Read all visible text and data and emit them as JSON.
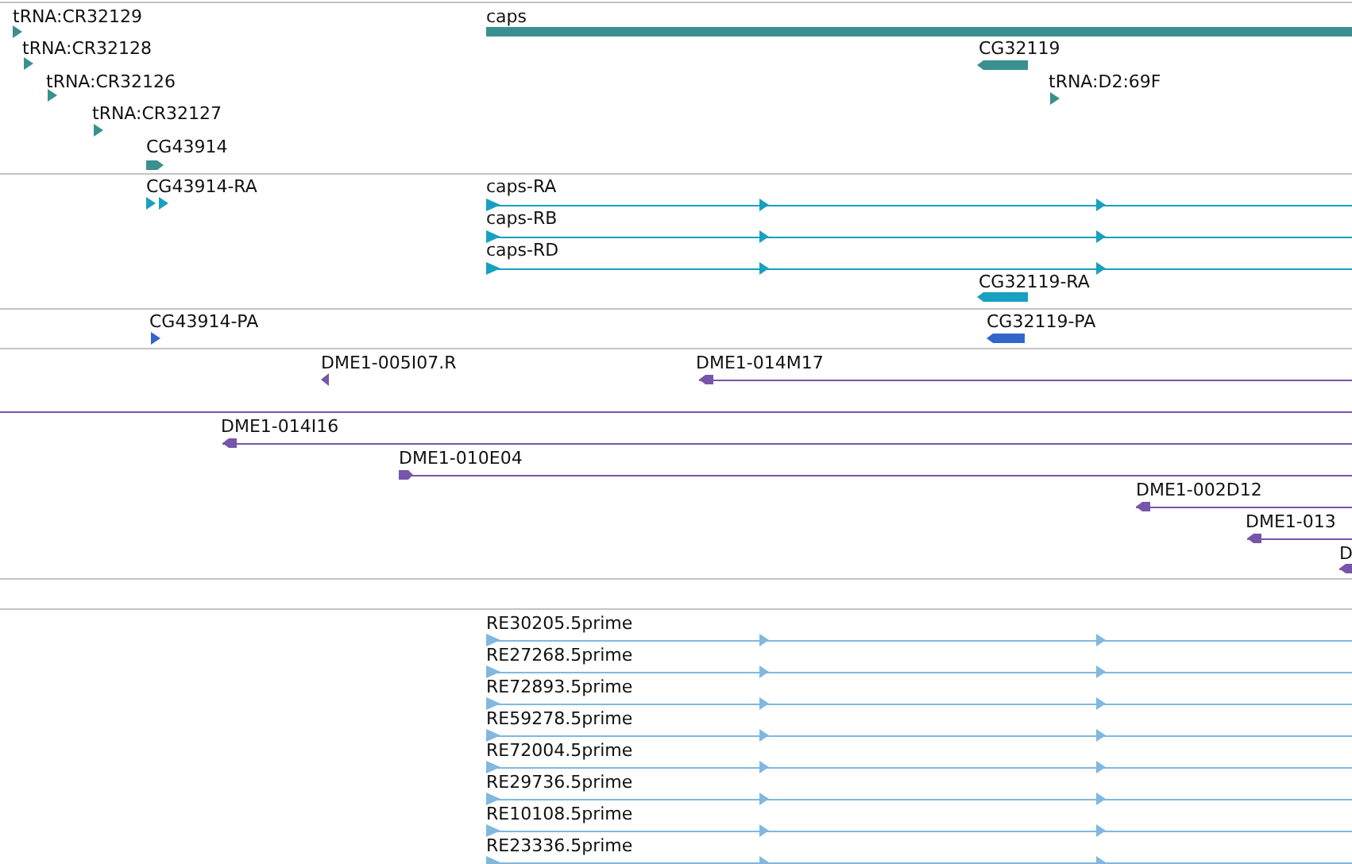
{
  "tracks": [
    {
      "color": "#3a9090",
      "features": [
        {
          "kind": "marker",
          "label": "tRNA:CR32129",
          "reverse": false
        },
        {
          "kind": "bar",
          "label": "caps"
        },
        {
          "kind": "marker",
          "label": "tRNA:CR32128",
          "reverse": false
        },
        {
          "kind": "bar",
          "label": "CG32119",
          "reverse": true
        },
        {
          "kind": "marker",
          "label": "tRNA:CR32126",
          "reverse": false
        },
        {
          "kind": "marker",
          "label": "tRNA:D2:69F",
          "reverse": false
        },
        {
          "kind": "marker",
          "label": "tRNA:CR32127",
          "reverse": false
        },
        {
          "kind": "bar",
          "label": "CG43914",
          "reverse": false
        }
      ]
    },
    {
      "color": "#18a0c0",
      "features": [
        {
          "kind": "marker",
          "label": "CG43914-RA",
          "reverse": false
        },
        {
          "kind": "spliced",
          "label": "caps-RA",
          "reverse": false
        },
        {
          "kind": "spliced",
          "label": "caps-RB",
          "reverse": false
        },
        {
          "kind": "spliced",
          "label": "caps-RD",
          "reverse": false
        },
        {
          "kind": "bar",
          "label": "CG32119-RA",
          "reverse": true
        }
      ]
    },
    {
      "color": "#3366cc",
      "features": [
        {
          "kind": "marker",
          "label": "CG43914-PA",
          "reverse": false
        },
        {
          "kind": "bar",
          "label": "CG32119-PA",
          "reverse": true
        }
      ]
    },
    {
      "color": "#7755aa",
      "features": [
        {
          "kind": "marker",
          "label": "DME1-005I07.R",
          "reverse": true
        },
        {
          "kind": "line",
          "label": "DME1-014M17",
          "reverse": true
        },
        {
          "kind": "line"
        },
        {
          "kind": "line",
          "label": "DME1-014I16",
          "reverse": true
        },
        {
          "kind": "line",
          "label": "DME1-010E04",
          "reverse": false
        },
        {
          "kind": "line",
          "label": "DME1-002D12",
          "reverse": true
        },
        {
          "kind": "line",
          "label": "DME1-013",
          "reverse": true
        },
        {
          "kind": "line",
          "label": "D",
          "reverse": true
        }
      ]
    },
    {
      "color": "#80b8e0",
      "features": [
        {
          "kind": "spliced",
          "label": "RE30205.5prime",
          "reverse": false
        },
        {
          "kind": "spliced",
          "label": "RE27268.5prime",
          "reverse": false
        },
        {
          "kind": "spliced",
          "label": "RE72893.5prime",
          "reverse": false
        },
        {
          "kind": "spliced",
          "label": "RE59278.5prime",
          "reverse": false
        },
        {
          "kind": "spliced",
          "label": "RE72004.5prime",
          "reverse": false
        },
        {
          "kind": "spliced",
          "label": "RE29736.5prime",
          "reverse": false
        },
        {
          "kind": "spliced",
          "label": "RE10108.5prime",
          "reverse": false
        },
        {
          "kind": "spliced",
          "label": "RE23336.5prime",
          "reverse": false
        }
      ]
    }
  ]
}
